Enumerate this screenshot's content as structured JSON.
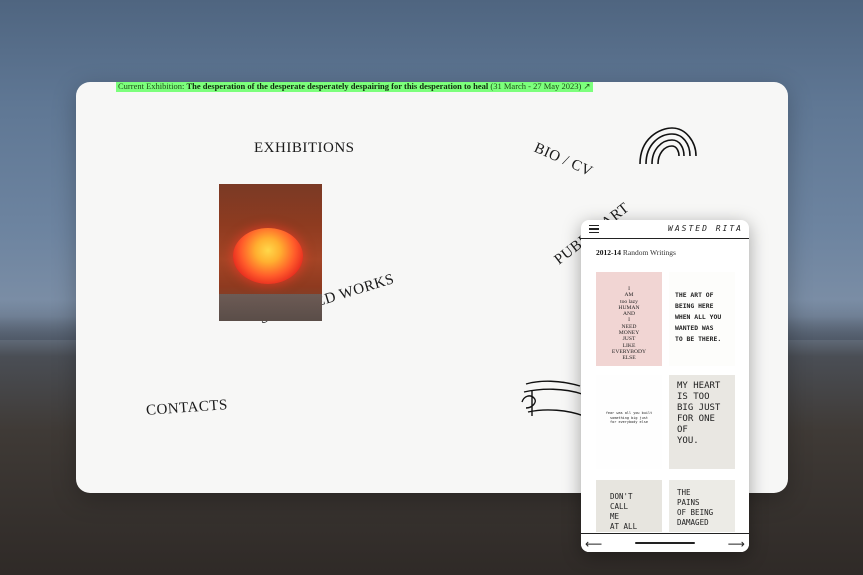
{
  "banner": {
    "prefix": "Current Exhibition: ",
    "title": "The desperation of the desperate desperately despairing for this desperation to heal",
    "dates": " (31 March - 27 May 2023) ↗"
  },
  "nav": {
    "exhibitions": "EXHIBITIONS",
    "bio": "BIO / CV",
    "public_art": "PUBLIC ART",
    "selected_works": "SELECTED WORKS",
    "contacts": "CONTACTS"
  },
  "phone": {
    "brand": "WASTED RITA",
    "heading_year": "2012-14",
    "heading_title": " Random Writings",
    "cards": [
      "I\nAM\ntoo lazy\nHUMAN\nAND\nI\nNEED\nMONEY\nJUST\nLIKE\nEVERYBODY\nELSE",
      "THE ART OF\nBEING HERE\nWHEN ALL YOU\nWANTED WAS\nTO BE THERE.",
      "fear was all you built\nsomething big just\nfor everybody else",
      "MY HEART\nIS TOO\nBIG JUST\nFOR ONE\nOF\nYOU.",
      "DON'T\nCALL\nME\nAT ALL",
      "THE\nPAINS\nOF BEING\nDAMAGED"
    ],
    "arrow_left": "⟵",
    "arrow_right": "⟶"
  },
  "icons": {
    "rainbow": "rainbow-doodle-icon",
    "hands": "hands-doodle-icon",
    "menu": "hamburger-menu-icon"
  }
}
